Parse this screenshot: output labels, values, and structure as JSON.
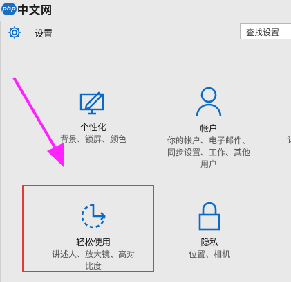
{
  "watermark": {
    "mark": "php",
    "text": "中文网"
  },
  "header": {
    "title": "设置",
    "search_placeholder": "查找设置"
  },
  "tiles": [
    {
      "name": "personalization",
      "title": "个性化",
      "desc_lines": [
        "背景、锁屏、颜色"
      ]
    },
    {
      "name": "accounts",
      "title": "帐户",
      "desc_lines": [
        "你的帐户、电子邮件、",
        "同步设置、工作、其他",
        "用户"
      ]
    },
    {
      "name": "ease-of-access",
      "title": "轻松使用",
      "desc_lines": [
        "讲述人、放大镜、高对",
        "比度"
      ]
    },
    {
      "name": "privacy",
      "title": "隐私",
      "desc_lines": [
        "位置、相机"
      ]
    }
  ],
  "partial_edge_text": "讠",
  "colors": {
    "accent": "#0b6ac7",
    "annotation_arrow": "#ff22ff",
    "annotation_box": "#e53935"
  }
}
